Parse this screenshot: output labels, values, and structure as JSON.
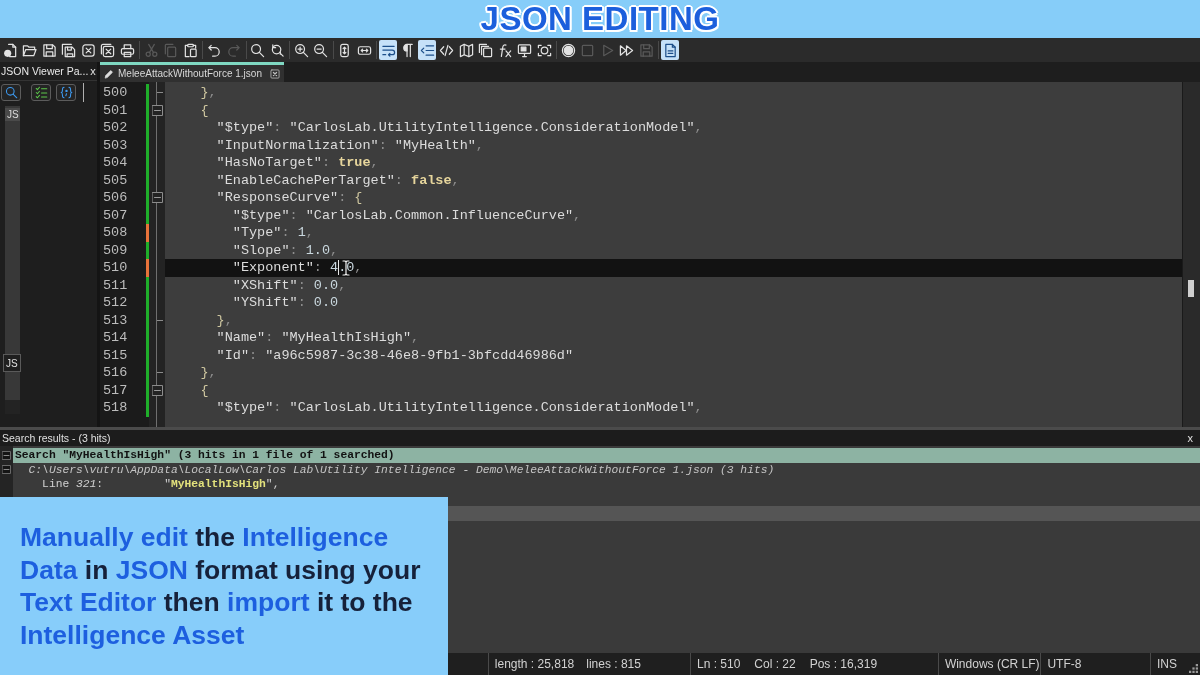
{
  "banner": {
    "title": "JSON EDITING"
  },
  "toolbar": {
    "groups": [
      {
        "buttons": [
          {
            "kind": "new",
            "on": false,
            "disabled": false
          },
          {
            "kind": "open",
            "on": false,
            "disabled": false
          },
          {
            "kind": "save",
            "on": false,
            "disabled": false
          },
          {
            "kind": "saveall",
            "on": false,
            "disabled": false
          },
          {
            "kind": "close",
            "on": false,
            "disabled": false
          },
          {
            "kind": "closeall",
            "on": false,
            "disabled": false
          },
          {
            "kind": "print",
            "on": false,
            "disabled": false
          }
        ]
      },
      {
        "buttons": [
          {
            "kind": "cut",
            "on": false,
            "disabled": true
          },
          {
            "kind": "copy",
            "on": false,
            "disabled": true
          },
          {
            "kind": "paste",
            "on": false,
            "disabled": false
          }
        ]
      },
      {
        "buttons": [
          {
            "kind": "undo",
            "on": false,
            "disabled": false
          },
          {
            "kind": "redo",
            "on": false,
            "disabled": true
          }
        ]
      },
      {
        "buttons": [
          {
            "kind": "find",
            "on": false,
            "disabled": false
          },
          {
            "kind": "replace",
            "on": false,
            "disabled": false
          }
        ]
      },
      {
        "buttons": [
          {
            "kind": "zoomin",
            "on": false,
            "disabled": false
          },
          {
            "kind": "zoomout",
            "on": false,
            "disabled": false
          }
        ]
      },
      {
        "buttons": [
          {
            "kind": "syncv",
            "on": false,
            "disabled": false
          },
          {
            "kind": "synch",
            "on": false,
            "disabled": false
          }
        ]
      },
      {
        "buttons": [
          {
            "kind": "wrap",
            "on": true,
            "disabled": false
          },
          {
            "kind": "allchars",
            "on": false,
            "disabled": false
          },
          {
            "kind": "indent",
            "on": true,
            "disabled": false
          },
          {
            "kind": "xml",
            "on": false,
            "disabled": false
          },
          {
            "kind": "docmap",
            "on": false,
            "disabled": false
          },
          {
            "kind": "doclist",
            "on": false,
            "disabled": false
          },
          {
            "kind": "function",
            "on": false,
            "disabled": false
          },
          {
            "kind": "workspace",
            "on": false,
            "disabled": false
          },
          {
            "kind": "monitor",
            "on": false,
            "disabled": false
          }
        ]
      },
      {
        "buttons": [
          {
            "kind": "record",
            "on": false,
            "disabled": false
          },
          {
            "kind": "stop",
            "on": false,
            "disabled": true
          },
          {
            "kind": "play",
            "on": false,
            "disabled": true
          },
          {
            "kind": "playmulti",
            "on": false,
            "disabled": false
          },
          {
            "kind": "savemacro",
            "on": false,
            "disabled": true
          }
        ]
      },
      {
        "buttons": [
          {
            "kind": "json",
            "on": true,
            "disabled": false
          }
        ]
      }
    ]
  },
  "json_viewer": {
    "title": "JSON Viewer Pa...",
    "close_label": "x",
    "tools": [
      {
        "kind": "search"
      },
      {
        "kind": "checklist"
      },
      {
        "kind": "braces"
      }
    ],
    "node_label": "JS",
    "box_label": "JS"
  },
  "editor": {
    "tabs": [
      {
        "label": "MeleeAttackWithoutForce 1.json",
        "selected": true
      }
    ],
    "lines": [
      {
        "number": "500",
        "modified": false,
        "current": false,
        "fold_start": false,
        "fold_end": true,
        "tokens": [
          {
            "kind": "brace",
            "text": "    }"
          },
          {
            "kind": "punct",
            "text": ","
          }
        ]
      },
      {
        "number": "501",
        "modified": false,
        "current": false,
        "fold_start": true,
        "fold_end": false,
        "tokens": [
          {
            "kind": "brace",
            "text": "    {"
          }
        ]
      },
      {
        "number": "502",
        "modified": false,
        "current": false,
        "fold_start": false,
        "fold_end": false,
        "tokens": [
          {
            "kind": "key",
            "text": "      \"$type\""
          },
          {
            "kind": "punct",
            "text": ": "
          },
          {
            "kind": "string",
            "text": "\"CarlosLab.UtilityIntelligence.ConsiderationModel\""
          },
          {
            "kind": "punct",
            "text": ","
          }
        ]
      },
      {
        "number": "503",
        "modified": false,
        "current": false,
        "fold_start": false,
        "fold_end": false,
        "tokens": [
          {
            "kind": "key",
            "text": "      \"InputNormalization\""
          },
          {
            "kind": "punct",
            "text": ": "
          },
          {
            "kind": "string",
            "text": "\"MyHealth\""
          },
          {
            "kind": "punct",
            "text": ","
          }
        ]
      },
      {
        "number": "504",
        "modified": false,
        "current": false,
        "fold_start": false,
        "fold_end": false,
        "tokens": [
          {
            "kind": "key",
            "text": "      \"HasNoTarget\""
          },
          {
            "kind": "punct",
            "text": ": "
          },
          {
            "kind": "keyword",
            "text": "true"
          },
          {
            "kind": "punct",
            "text": ","
          }
        ]
      },
      {
        "number": "505",
        "modified": false,
        "current": false,
        "fold_start": false,
        "fold_end": false,
        "tokens": [
          {
            "kind": "key",
            "text": "      \"EnableCachePerTarget\""
          },
          {
            "kind": "punct",
            "text": ": "
          },
          {
            "kind": "keyword",
            "text": "false"
          },
          {
            "kind": "punct",
            "text": ","
          }
        ]
      },
      {
        "number": "506",
        "modified": false,
        "current": false,
        "fold_start": true,
        "fold_end": false,
        "tokens": [
          {
            "kind": "key",
            "text": "      \"ResponseCurve\""
          },
          {
            "kind": "punct",
            "text": ": "
          },
          {
            "kind": "brace",
            "text": "{"
          }
        ]
      },
      {
        "number": "507",
        "modified": false,
        "current": false,
        "fold_start": false,
        "fold_end": false,
        "tokens": [
          {
            "kind": "key",
            "text": "        \"$type\""
          },
          {
            "kind": "punct",
            "text": ": "
          },
          {
            "kind": "string",
            "text": "\"CarlosLab.Common.InfluenceCurve\""
          },
          {
            "kind": "punct",
            "text": ","
          }
        ]
      },
      {
        "number": "508",
        "modified": true,
        "current": false,
        "fold_start": false,
        "fold_end": false,
        "tokens": [
          {
            "kind": "key",
            "text": "        \"Type\""
          },
          {
            "kind": "punct",
            "text": ": "
          },
          {
            "kind": "number",
            "text": "1"
          },
          {
            "kind": "punct",
            "text": ","
          }
        ]
      },
      {
        "number": "509",
        "modified": false,
        "current": false,
        "fold_start": false,
        "fold_end": false,
        "tokens": [
          {
            "kind": "key",
            "text": "        \"Slope\""
          },
          {
            "kind": "punct",
            "text": ": "
          },
          {
            "kind": "number",
            "text": "1.0"
          },
          {
            "kind": "punct",
            "text": ","
          }
        ]
      },
      {
        "number": "510",
        "modified": true,
        "current": true,
        "fold_start": false,
        "fold_end": false,
        "tokens": [
          {
            "kind": "key",
            "text": "        \"Exponent\""
          },
          {
            "kind": "punct",
            "text": ": "
          },
          {
            "kind": "number",
            "text": "4"
          },
          {
            "kind": "caret"
          },
          {
            "kind": "number",
            "text": ".0"
          },
          {
            "kind": "punct",
            "text": ","
          }
        ]
      },
      {
        "number": "511",
        "modified": false,
        "current": false,
        "fold_start": false,
        "fold_end": false,
        "tokens": [
          {
            "kind": "key",
            "text": "        \"XShift\""
          },
          {
            "kind": "punct",
            "text": ": "
          },
          {
            "kind": "number",
            "text": "0.0"
          },
          {
            "kind": "punct",
            "text": ","
          }
        ]
      },
      {
        "number": "512",
        "modified": false,
        "current": false,
        "fold_start": false,
        "fold_end": false,
        "tokens": [
          {
            "kind": "key",
            "text": "        \"YShift\""
          },
          {
            "kind": "punct",
            "text": ": "
          },
          {
            "kind": "number",
            "text": "0.0"
          }
        ]
      },
      {
        "number": "513",
        "modified": false,
        "current": false,
        "fold_start": false,
        "fold_end": true,
        "tokens": [
          {
            "kind": "brace",
            "text": "      }"
          },
          {
            "kind": "punct",
            "text": ","
          }
        ]
      },
      {
        "number": "514",
        "modified": false,
        "current": false,
        "fold_start": false,
        "fold_end": false,
        "tokens": [
          {
            "kind": "key",
            "text": "      \"Name\""
          },
          {
            "kind": "punct",
            "text": ": "
          },
          {
            "kind": "string",
            "text": "\"MyHealthIsHigh\""
          },
          {
            "kind": "punct",
            "text": ","
          }
        ]
      },
      {
        "number": "515",
        "modified": false,
        "current": false,
        "fold_start": false,
        "fold_end": false,
        "tokens": [
          {
            "kind": "key",
            "text": "      \"Id\""
          },
          {
            "kind": "punct",
            "text": ": "
          },
          {
            "kind": "string",
            "text": "\"a96c5987-3c38-46e8-9fb1-3bfcdd46986d\""
          }
        ]
      },
      {
        "number": "516",
        "modified": false,
        "current": false,
        "fold_start": false,
        "fold_end": true,
        "tokens": [
          {
            "kind": "brace",
            "text": "    }"
          },
          {
            "kind": "punct",
            "text": ","
          }
        ]
      },
      {
        "number": "517",
        "modified": false,
        "current": false,
        "fold_start": true,
        "fold_end": false,
        "tokens": [
          {
            "kind": "brace",
            "text": "    {"
          }
        ]
      },
      {
        "number": "518",
        "modified": false,
        "current": false,
        "fold_start": false,
        "fold_end": false,
        "tokens": [
          {
            "kind": "key",
            "text": "      \"$type\""
          },
          {
            "kind": "punct",
            "text": ": "
          },
          {
            "kind": "string",
            "text": "\"CarlosLab.UtilityIntelligence.ConsiderationModel\""
          },
          {
            "kind": "punct",
            "text": ","
          }
        ]
      }
    ]
  },
  "search_results": {
    "title": "Search results - (3 hits)",
    "close_label": "x",
    "query_line": "Search \"MyHealthIsHigh\" (3 hits in 1 file of 1 searched)",
    "file_line": "C:\\Users\\vutru\\AppData\\LocalLow\\Carlos Lab\\Utility Intelligence - Demo\\MeleeAttackWithoutForce 1.json (3 hits)",
    "hits": [
      "Line *321*:         \"**MyHealthIsHigh**\","
    ]
  },
  "callout": {
    "text": "**Manually edit** the **Intelligence Data** in **JSON** format using your **Text Editor** then **import** it to the **Intelligence Asset**"
  },
  "status_bar": {
    "length": "length : 25,818",
    "lines": "lines : 815",
    "line": "Ln : 510",
    "column": "Col : 22",
    "position": "Pos : 16,319",
    "eol": "Windows (CR LF)",
    "encoding": "UTF-8",
    "mode": "INS"
  }
}
